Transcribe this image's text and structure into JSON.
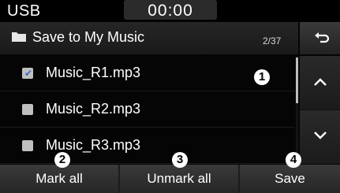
{
  "status": {
    "source": "USB",
    "time": "00:00"
  },
  "header": {
    "title": "Save to My Music",
    "page_count": "2/37",
    "back_icon": "back-arrow-icon",
    "folder_icon": "folder-icon"
  },
  "list": {
    "items": [
      {
        "label": "Music_R1.mp3",
        "checked": true
      },
      {
        "label": "Music_R2.mp3",
        "checked": false
      },
      {
        "label": "Music_R3.mp3",
        "checked": false
      }
    ]
  },
  "scroll": {
    "up_icon": "chevron-up-icon",
    "down_icon": "chevron-down-icon"
  },
  "buttons": {
    "mark_all": "Mark all",
    "unmark_all": "Unmark all",
    "save": "Save"
  },
  "markers": [
    "1",
    "2",
    "3",
    "4"
  ],
  "colors": {
    "check_accent": "#3b66c9",
    "background": "#050505"
  }
}
